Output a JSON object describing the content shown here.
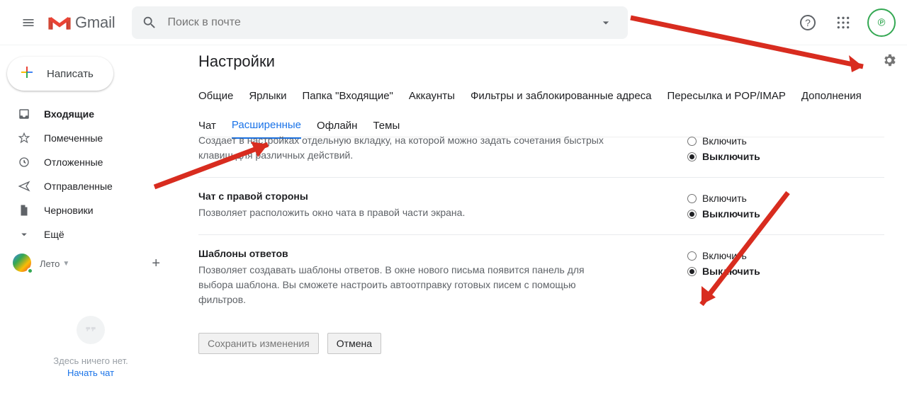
{
  "header": {
    "brand": "Gmail",
    "search_placeholder": "Поиск в почте"
  },
  "compose_label": "Написать",
  "sidebar": {
    "items": [
      {
        "label": "Входящие",
        "icon": "inbox"
      },
      {
        "label": "Помеченные",
        "icon": "star"
      },
      {
        "label": "Отложенные",
        "icon": "clock"
      },
      {
        "label": "Отправленные",
        "icon": "send"
      },
      {
        "label": "Черновики",
        "icon": "file"
      },
      {
        "label": "Ещё",
        "icon": "chevron-down"
      }
    ],
    "hangouts_user": "Лето",
    "hangouts_empty": "Здесь ничего нет.",
    "hangouts_start": "Начать чат"
  },
  "settings": {
    "title": "Настройки",
    "tabs": [
      "Общие",
      "Ярлыки",
      "Папка \"Входящие\"",
      "Аккаунты",
      "Фильтры и заблокированные адреса",
      "Пересылка и POP/IMAP",
      "Дополнения"
    ],
    "tabs_row2": [
      "Чат",
      "Расширенные",
      "Офлайн",
      "Темы"
    ],
    "active_tab": "Расширенные",
    "items": [
      {
        "title": "",
        "body": "Создает в настройках отдельную вкладку, на которой можно задать сочетания быстрых клавиш для различных действий.",
        "enable": "Включить",
        "disable": "Выключить",
        "selected": "disable"
      },
      {
        "title": "Чат с правой стороны",
        "body": "Позволяет расположить окно чата в правой части экрана.",
        "enable": "Включить",
        "disable": "Выключить",
        "selected": "disable"
      },
      {
        "title": "Шаблоны ответов",
        "body": "Позволяет создавать шаблоны ответов. В окне нового письма появится панель для выбора шаблона. Вы сможете настроить автоотправку готовых писем с помощью фильтров.",
        "enable": "Включить",
        "disable": "Выключить",
        "selected": "disable"
      }
    ],
    "save_btn": "Сохранить изменения",
    "cancel_btn": "Отмена"
  }
}
